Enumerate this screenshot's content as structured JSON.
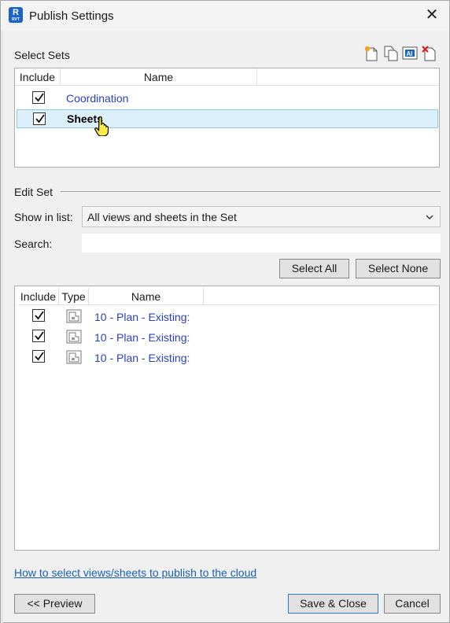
{
  "window": {
    "title": "Publish Settings",
    "app_icon_letter": "R",
    "app_icon_sub": "RVT"
  },
  "select_sets": {
    "label": "Select Sets",
    "toolbar_icons": [
      "new-set-icon",
      "duplicate-set-icon",
      "rename-set-icon",
      "delete-set-icon"
    ],
    "columns": [
      "Include",
      "Name"
    ],
    "rows": [
      {
        "included": true,
        "name": "Coordination",
        "selected": false
      },
      {
        "included": true,
        "name": "Sheets",
        "selected": true
      }
    ]
  },
  "edit_set": {
    "label": "Edit Set",
    "show_in_list_label": "Show in list:",
    "show_in_list_value": "All views and sheets in the Set",
    "search_label": "Search:",
    "search_value": "",
    "select_all_label": "Select All",
    "select_none_label": "Select None",
    "columns": [
      "Include",
      "Type",
      "Name"
    ],
    "rows": [
      {
        "included": true,
        "type_icon": "plan-view-icon",
        "name": "10 - Plan - Existing:"
      },
      {
        "included": true,
        "type_icon": "plan-view-icon",
        "name": "10 - Plan - Existing:"
      },
      {
        "included": true,
        "type_icon": "plan-view-icon",
        "name": "10 - Plan - Existing:"
      }
    ]
  },
  "help_link": "How to select views/sheets to publish to the cloud",
  "footer": {
    "preview_label": "<< Preview",
    "save_close_label": "Save & Close",
    "cancel_label": "Cancel"
  },
  "colors": {
    "link": "#2a3fc2",
    "selection_bg": "#dcf0fb",
    "selection_border": "#8fc9ea",
    "app_icon": "#1c63c7"
  }
}
